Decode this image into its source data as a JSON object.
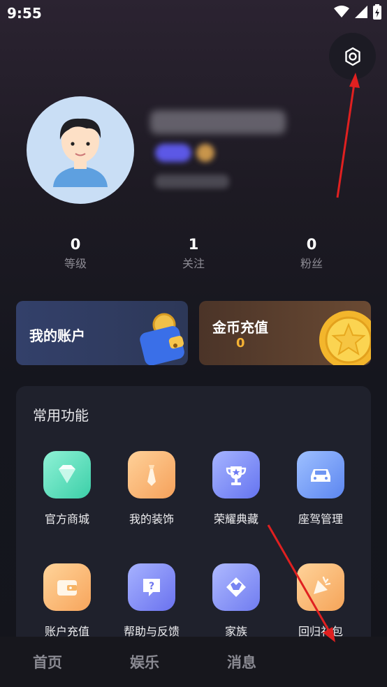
{
  "status_bar": {
    "time": "9:55"
  },
  "profile": {
    "stats": [
      {
        "value": "0",
        "label": "等级"
      },
      {
        "value": "1",
        "label": "关注"
      },
      {
        "value": "0",
        "label": "粉丝"
      }
    ]
  },
  "cards": {
    "account": {
      "title": "我的账户"
    },
    "coin": {
      "title": "金币充值",
      "value": "0"
    }
  },
  "functions": {
    "title": "常用功能",
    "items": [
      {
        "label": "官方商城",
        "icon": "diamond-icon"
      },
      {
        "label": "我的装饰",
        "icon": "tie-icon"
      },
      {
        "label": "荣耀典藏",
        "icon": "trophy-icon"
      },
      {
        "label": "座驾管理",
        "icon": "car-icon"
      },
      {
        "label": "账户充值",
        "icon": "wallet-icon"
      },
      {
        "label": "帮助与反馈",
        "icon": "help-icon"
      },
      {
        "label": "家族",
        "icon": "family-icon"
      },
      {
        "label": "回归礼包",
        "icon": "gift-icon"
      }
    ]
  },
  "bottom_nav": {
    "items": [
      "首页",
      "娱乐",
      "消息"
    ]
  },
  "colors": {
    "accent_coin": "#f5b234",
    "annotation_arrow": "#e02020"
  }
}
